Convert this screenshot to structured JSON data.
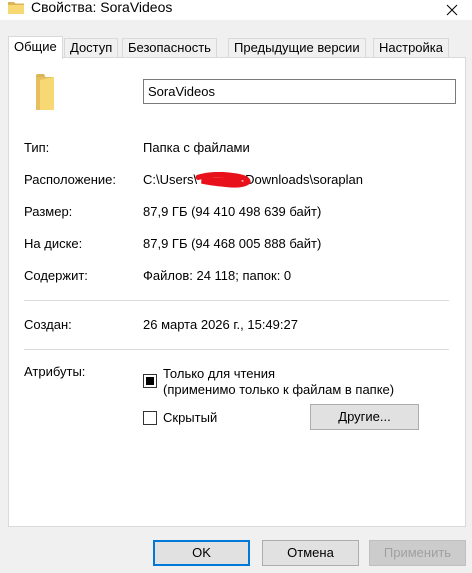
{
  "window": {
    "title": "Свойства: SoraVideos",
    "close_icon": "close-icon",
    "folder_icon": "folder-icon"
  },
  "tabs": [
    {
      "label": "Общие",
      "active": true
    },
    {
      "label": "Доступ",
      "active": false
    },
    {
      "label": "Безопасность",
      "active": false
    },
    {
      "label": "Предыдущие версии",
      "active": false
    },
    {
      "label": "Настройка",
      "active": false
    }
  ],
  "general": {
    "name_value": "SoraVideos",
    "type_label": "Тип:",
    "type_value": "Папка с файлами",
    "location_label": "Расположение:",
    "location_value_start": "C:\\Users\\",
    "location_value_end": "Downloads\\soraplan",
    "size_label": "Размер:",
    "size_value": "87,9 ГБ (94 410 498 639 байт)",
    "ondisk_label": "На диске:",
    "ondisk_value": "87,9 ГБ (94 468 005 888 байт)",
    "contains_label": "Содержит:",
    "contains_value": "Файлов: 24 118; папок: 0",
    "created_label": "Создан:",
    "created_value": "26 марта 2026 г., 15:49:27",
    "attributes_label": "Атрибуты:",
    "readonly_label": "Только для чтения",
    "readonly_note": "(применимо только к файлам в папке)",
    "readonly_state": "indeterminate",
    "hidden_label": "Скрытый",
    "hidden_state": "unchecked",
    "other_button": "Другие..."
  },
  "buttons": {
    "ok": "OK",
    "cancel": "Отмена",
    "apply": "Применить"
  },
  "colors": {
    "accent": "#0078d7",
    "folder": "#f8d775",
    "redaction": "#e8111b"
  }
}
